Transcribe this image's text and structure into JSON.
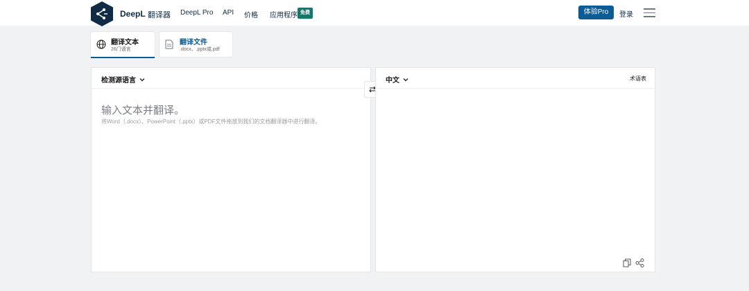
{
  "header": {
    "brand": "DeepL",
    "brand_sub": "翻译器",
    "nav": [
      "DeepL Pro",
      "API",
      "价格",
      "应用程序"
    ],
    "badge": "免费",
    "pro_button": "体验Pro",
    "login": "登录",
    "logo_icon": "deepl-logo-icon",
    "menu_icon": "hamburger-menu-icon"
  },
  "tabs": [
    {
      "title": "翻译文本",
      "sub": "26门语言",
      "icon": "globe-icon",
      "active": true
    },
    {
      "title": "翻译文件",
      "sub": ".docx、.pptx或.pdf",
      "icon": "document-icon",
      "active": false
    }
  ],
  "source": {
    "language": "检测源语言",
    "placeholder": "输入文本并翻译。",
    "hint": "将Word（.docx）、PowerPoint（.pptx）或PDF文件拖放到我们的文档翻译器中进行翻译。"
  },
  "target": {
    "language": "中文",
    "glossary": "术语表"
  },
  "colors": {
    "brand_dark": "#0f2b46",
    "pro_button": "#0b5b94",
    "badge": "#0f7a6b",
    "background": "#f1f2f4"
  }
}
